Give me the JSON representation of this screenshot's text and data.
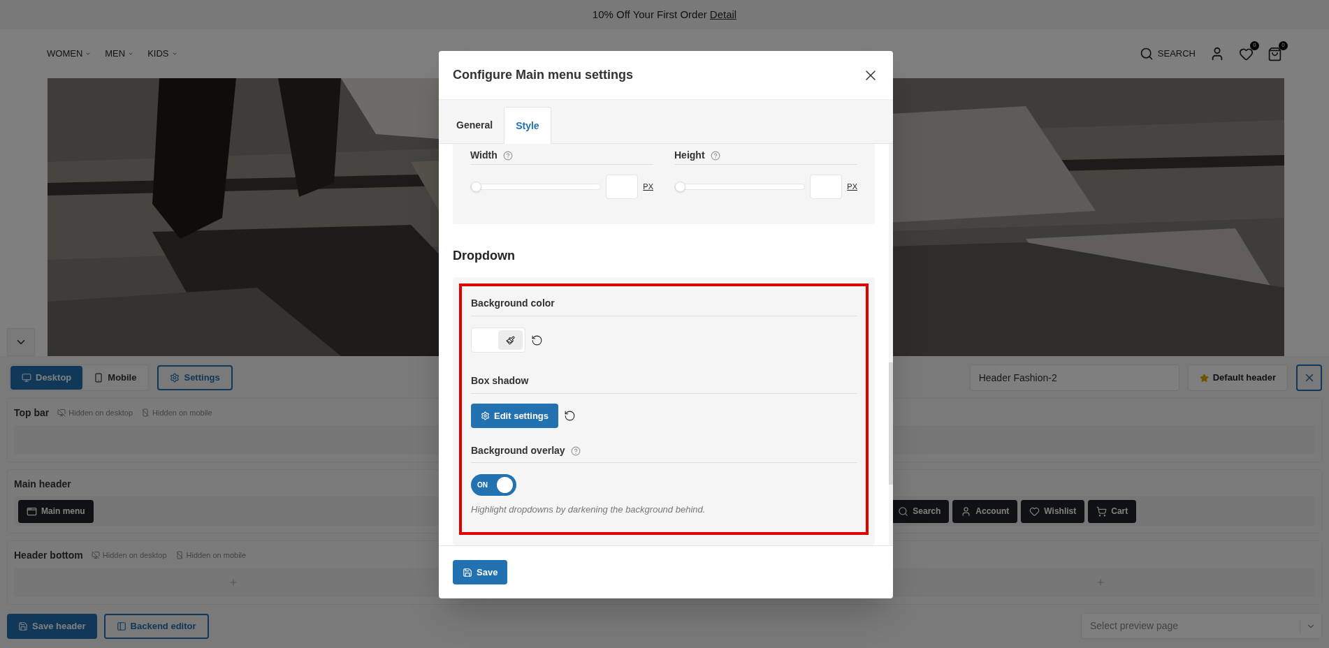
{
  "announcement": {
    "text": "10% Off Your First Order",
    "link": "Detail"
  },
  "nav": {
    "links": [
      {
        "label": "WOMEN"
      },
      {
        "label": "MEN"
      },
      {
        "label": "KIDS"
      }
    ],
    "search_label": "SEARCH",
    "wishlist_count": "0",
    "cart_count": "0"
  },
  "builder": {
    "devices": [
      {
        "kind": "desktop",
        "label": "Desktop",
        "selected": true
      },
      {
        "kind": "mobile",
        "label": "Mobile",
        "selected": false
      }
    ],
    "settings_button": "Settings",
    "header_name": "Header Fashion-2",
    "default_button": "Default header",
    "rows": [
      {
        "title": "Top bar",
        "notes": [
          {
            "kind": "desktop",
            "text": "Hidden on desktop"
          },
          {
            "kind": "mobile",
            "text": "Hidden on mobile"
          }
        ],
        "left": [],
        "right": []
      },
      {
        "title": "Main header",
        "notes": [],
        "left": [
          {
            "kind": "menu",
            "label": "Main menu"
          }
        ],
        "right": [
          {
            "kind": "search",
            "label": "Search"
          },
          {
            "kind": "account",
            "label": "Account"
          },
          {
            "kind": "wishlist",
            "label": "Wishlist"
          },
          {
            "kind": "cart",
            "label": "Cart"
          }
        ]
      },
      {
        "title": "Header bottom",
        "notes": [
          {
            "kind": "desktop",
            "text": "Hidden on desktop"
          },
          {
            "kind": "mobile",
            "text": "Hidden on mobile"
          }
        ],
        "left": [],
        "right": [],
        "add_buttons": true
      }
    ],
    "save_button": "Save header",
    "backend_button": "Backend editor",
    "preview_select": {
      "placeholder": "Select preview page"
    }
  },
  "modal": {
    "title": "Configure Main menu settings",
    "tabs": [
      {
        "label": "General",
        "selected": false
      },
      {
        "label": "Style",
        "selected": true
      }
    ],
    "size_fields": [
      {
        "label": "Width",
        "level": 0,
        "unit": "PX"
      },
      {
        "label": "Height",
        "level": 0,
        "unit": "PX"
      }
    ],
    "section_title": "Dropdown",
    "background_color": {
      "label": "Background color"
    },
    "box_shadow": {
      "label": "Box shadow",
      "button": "Edit settings"
    },
    "overlay": {
      "label": "Background overlay",
      "on": true,
      "toggle_text": "ON",
      "description": "Highlight dropdowns by darkening the background behind."
    },
    "save_button": "Save"
  }
}
